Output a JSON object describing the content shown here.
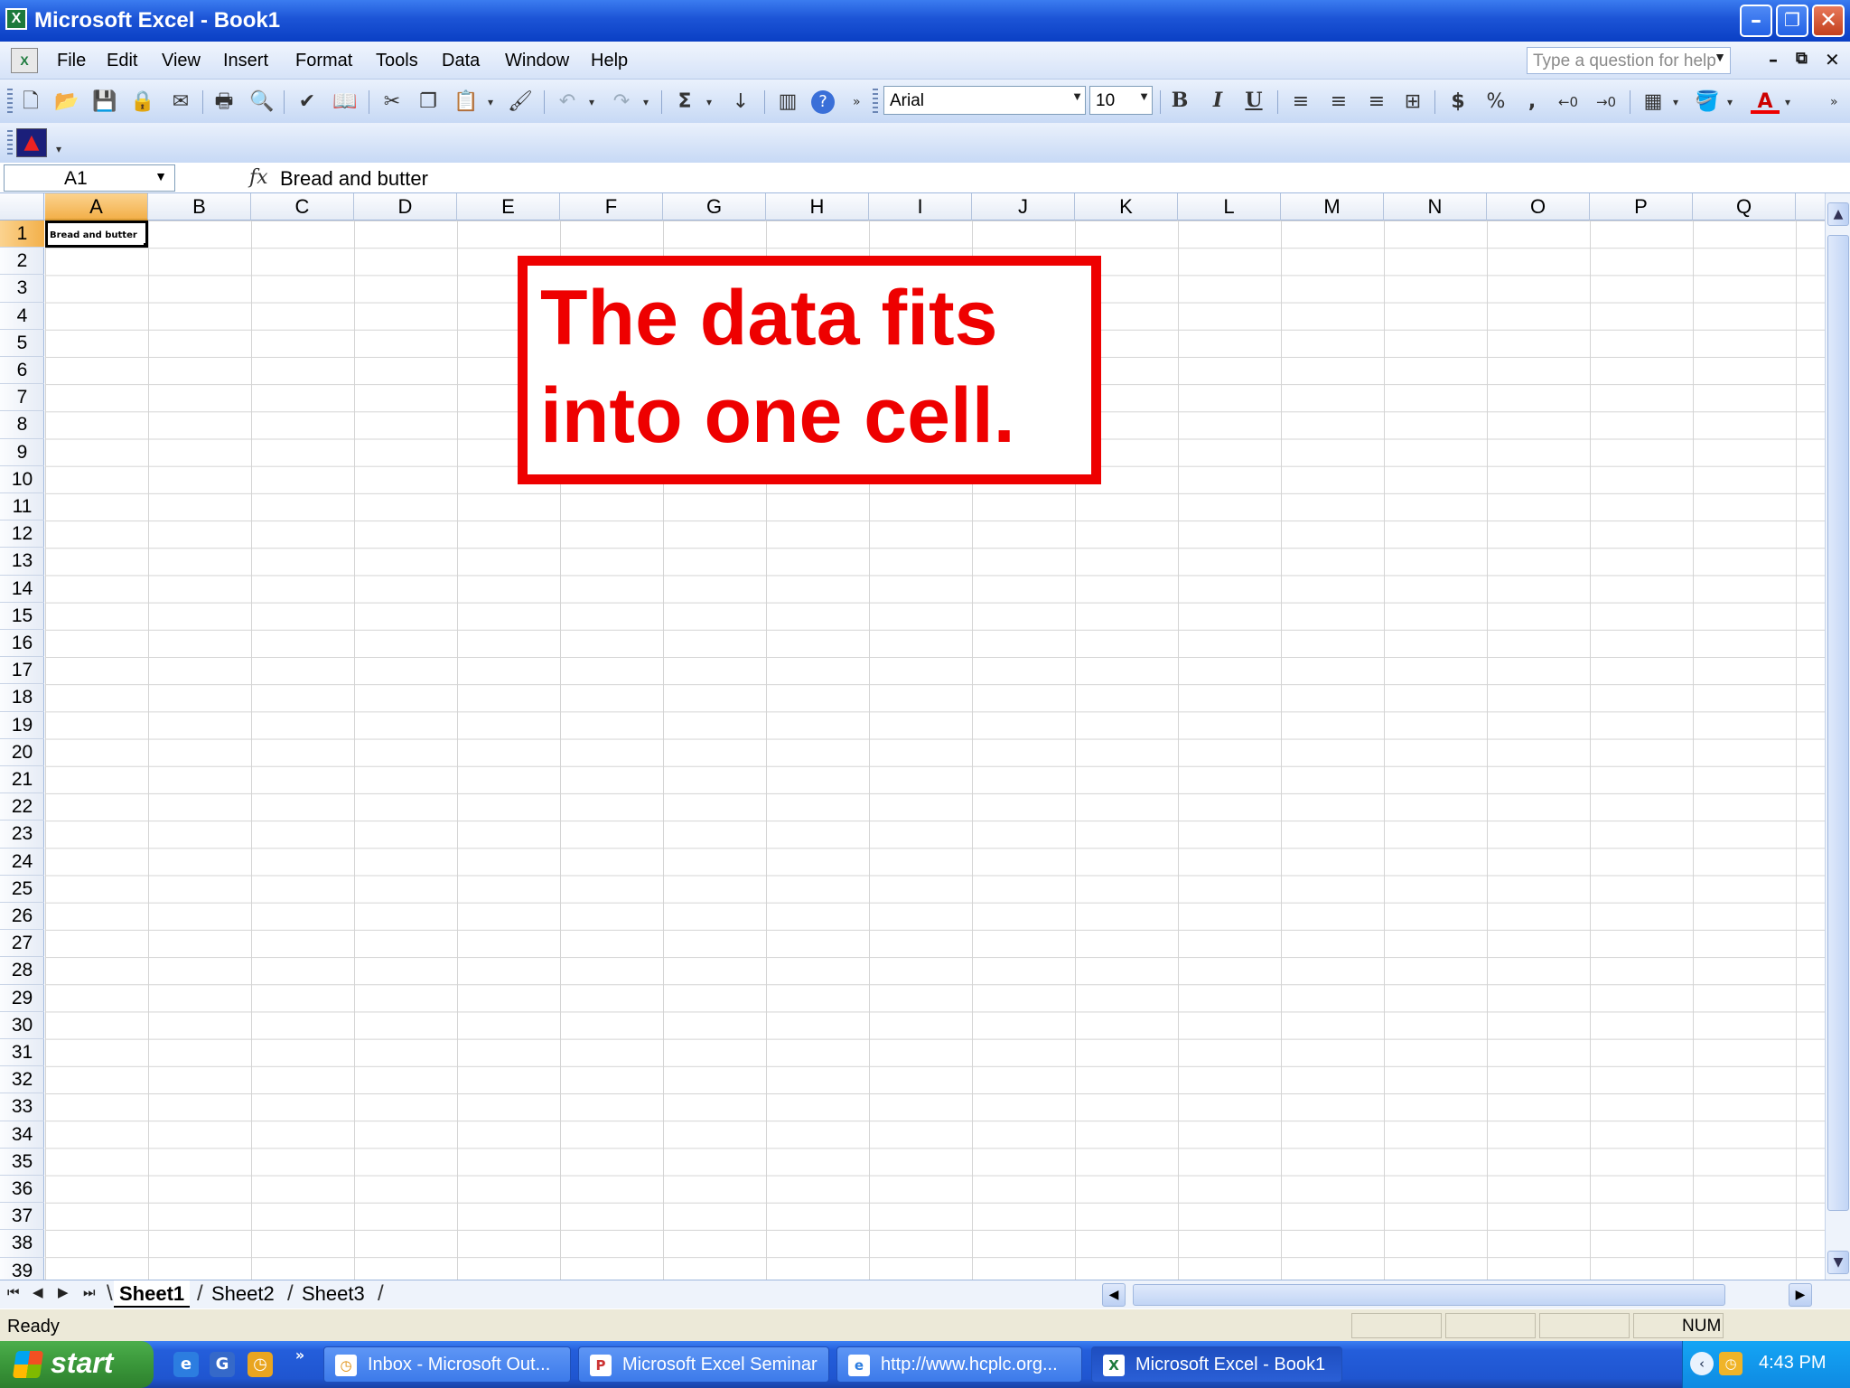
{
  "window": {
    "title": "Microsoft Excel - Book1",
    "app_icon": "X",
    "minimize": "–",
    "restore": "❐",
    "close": "✕"
  },
  "menubar": {
    "items": [
      "File",
      "Edit",
      "View",
      "Insert",
      "Format",
      "Tools",
      "Data",
      "Window",
      "Help"
    ],
    "help_placeholder": "Type a question for help",
    "doc_minimize": "–",
    "doc_restore": "⧉",
    "doc_close": "✕"
  },
  "toolbar": {
    "font_name": "Arial",
    "font_size": "10",
    "icons": [
      "new-icon",
      "open-icon",
      "save-icon",
      "permission-icon",
      "email-icon",
      "print-icon",
      "print-preview-icon",
      "spelling-icon",
      "research-icon",
      "cut-icon",
      "copy-icon",
      "paste-icon",
      "format-painter-icon",
      "undo-icon",
      "redo-icon",
      "autosum-icon",
      "sort-ascending-icon",
      "chart-wizard-icon",
      "help-icon"
    ],
    "glyphs": {
      "new": "🗋",
      "open": "📂",
      "save": "💾",
      "permission": "🔒",
      "email": "✉",
      "print": "🖶",
      "preview": "🔍",
      "spelling": "✔",
      "research": "📖",
      "cut": "✂",
      "copy": "❐",
      "paste": "📋",
      "painter": "🖌",
      "undo": "↶",
      "redo": "↷",
      "sigma": "Σ",
      "sort": "↓",
      "chart": "▥",
      "help": "?",
      "bold": "B",
      "italic": "I",
      "underline": "U",
      "align_left": "≡",
      "center": "≡",
      "align_right": "≡",
      "merge": "⊞",
      "currency": "$",
      "percent": "%",
      "comma": ",",
      "inc_decimal": "←0",
      "dec_decimal": "→0",
      "borders": "▦",
      "fill": "🪣",
      "font_color": "A",
      "dropdown": "▾",
      "dropdown_caret": "▼",
      "overflow": "»"
    }
  },
  "toolbar2": {
    "addin_icon": "▲"
  },
  "formula_bar": {
    "name_box": "A1",
    "fx_label": "fx",
    "content": "Bread and butter"
  },
  "sheet": {
    "columns": [
      "A",
      "B",
      "C",
      "D",
      "E",
      "F",
      "G",
      "H",
      "I",
      "J",
      "K",
      "L",
      "M",
      "N",
      "O",
      "P",
      "Q"
    ],
    "row_count": 39,
    "active_cell": "A1",
    "a1_value": "Bread and butter"
  },
  "callout": {
    "line1": "The data fits",
    "line2": "into one cell.",
    "color": "#ee0000"
  },
  "sheet_tabs": {
    "tabs": [
      "Sheet1",
      "Sheet2",
      "Sheet3"
    ],
    "active": "Sheet1",
    "nav": [
      "⏮",
      "◀",
      "▶",
      "⏭"
    ]
  },
  "scroll": {
    "up": "▲",
    "down": "▼",
    "left": "◀",
    "right": "▶"
  },
  "statusbar": {
    "status": "Ready",
    "num_lock": "NUM"
  },
  "taskbar": {
    "start_label": "start",
    "quicklaunch": [
      "e",
      "G",
      "◷",
      "»"
    ],
    "tasks": [
      {
        "label": "Inbox - Microsoft Out...",
        "icon": "◷"
      },
      {
        "label": "Microsoft Excel Seminar",
        "icon": "P"
      },
      {
        "label": "http://www.hcplc.org...",
        "icon": "e"
      },
      {
        "label": "Microsoft Excel - Book1",
        "icon": "X"
      }
    ],
    "tray_icons": [
      "‹",
      "◷"
    ],
    "clock": "4:43 PM"
  }
}
